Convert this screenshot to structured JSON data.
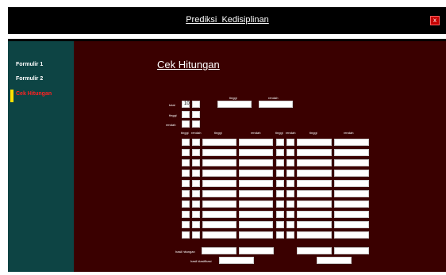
{
  "window": {
    "title": "Prediksi  Kedisiplinan",
    "close_symbol": "x"
  },
  "sidebar": {
    "items": [
      {
        "label": "Formulir 1"
      },
      {
        "label": "Formulir 2"
      },
      {
        "label": "Cek Hitungan"
      }
    ]
  },
  "main": {
    "heading": "Cek Hitungan",
    "top_labels": {
      "tinggi": "tinggi",
      "rendah": "rendah"
    },
    "row_labels": {
      "total": "total",
      "tinggi": "tinggi",
      "rendah": "rendah"
    },
    "total_value": "10",
    "col_headers": {
      "tinggi_a": "tinggi",
      "rendah_a": "rendah",
      "tinggi_b": "tinggi",
      "rendah_b": "rendah",
      "tinggi_c": "tinggi",
      "rendah_c": "rendah",
      "tinggi_d": "tinggi",
      "rendah_d": "rendah"
    },
    "hasil_hitungan_label": "hasil hitungan",
    "hasil_klasifikasi_label": "hasil klasifikasi"
  },
  "colors": {
    "titlebar": "#000000",
    "sidebar": "#0d4444",
    "main_bg": "#3a0000",
    "active_nav": "#ff2222",
    "marker": "#ffe000",
    "close": "#c40000"
  }
}
